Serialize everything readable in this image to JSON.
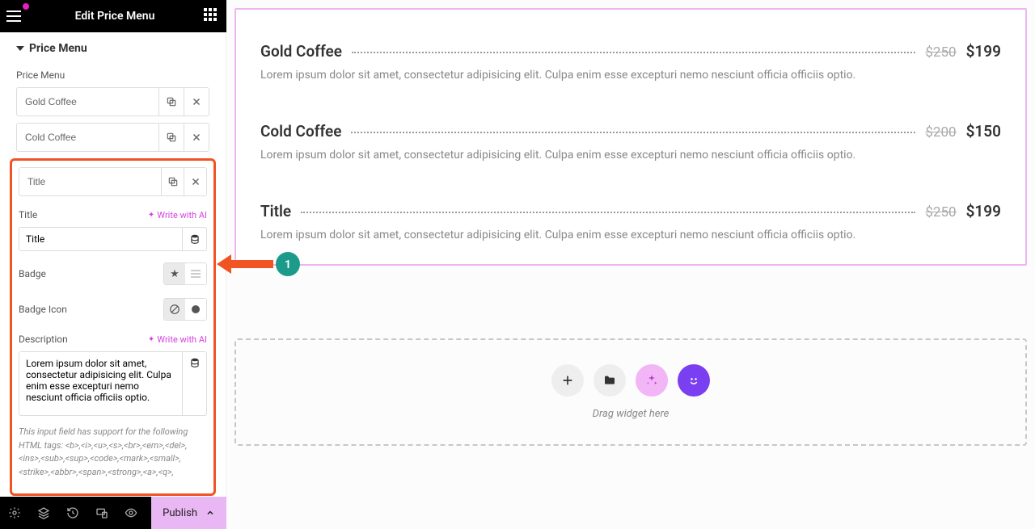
{
  "topbar": {
    "title": "Edit Price Menu"
  },
  "section": {
    "title": "Price Menu",
    "sublabel": "Price Menu"
  },
  "items": [
    {
      "name": "Gold Coffee"
    },
    {
      "name": "Cold Coffee"
    }
  ],
  "expanded": {
    "rowLabel": "Title",
    "titleLabel": "Title",
    "titleValue": "Title",
    "writeAi": "Write with AI",
    "badgeLabel": "Badge",
    "badgeIconLabel": "Badge Icon",
    "descLabel": "Description",
    "descValue": "Lorem ipsum dolor sit amet, consectetur adipisicing elit. Culpa enim esse excepturi nemo nesciunt officia officiis optio.",
    "htmlHint": "This input field has support for the following HTML tags: <b>,<i>,<u>,<s>,<br>,<em>,<del>,<ins>,<sub>,<sup>,<code>,<mark>,<small>,<strike>,<abbr>,<span>,<strong>,<a>,<q>,"
  },
  "publish": {
    "label": "Publish"
  },
  "preview": {
    "items": [
      {
        "title": "Gold Coffee",
        "old": "$250",
        "new": "$199",
        "desc": "Lorem ipsum dolor sit amet, consectetur adipisicing elit. Culpa enim esse excepturi nemo nesciunt officia officiis optio."
      },
      {
        "title": "Cold Coffee",
        "old": "$200",
        "new": "$150",
        "desc": "Lorem ipsum dolor sit amet, consectetur adipisicing elit. Culpa enim esse excepturi nemo nesciunt officia officiis optio."
      },
      {
        "title": "Title",
        "old": "$250",
        "new": "$199",
        "desc": "Lorem ipsum dolor sit amet, consectetur adipisicing elit. Culpa enim esse excepturi nemo nesciunt officia officiis optio."
      }
    ]
  },
  "dropzone": {
    "label": "Drag widget here"
  },
  "annotation": {
    "step": "1"
  }
}
